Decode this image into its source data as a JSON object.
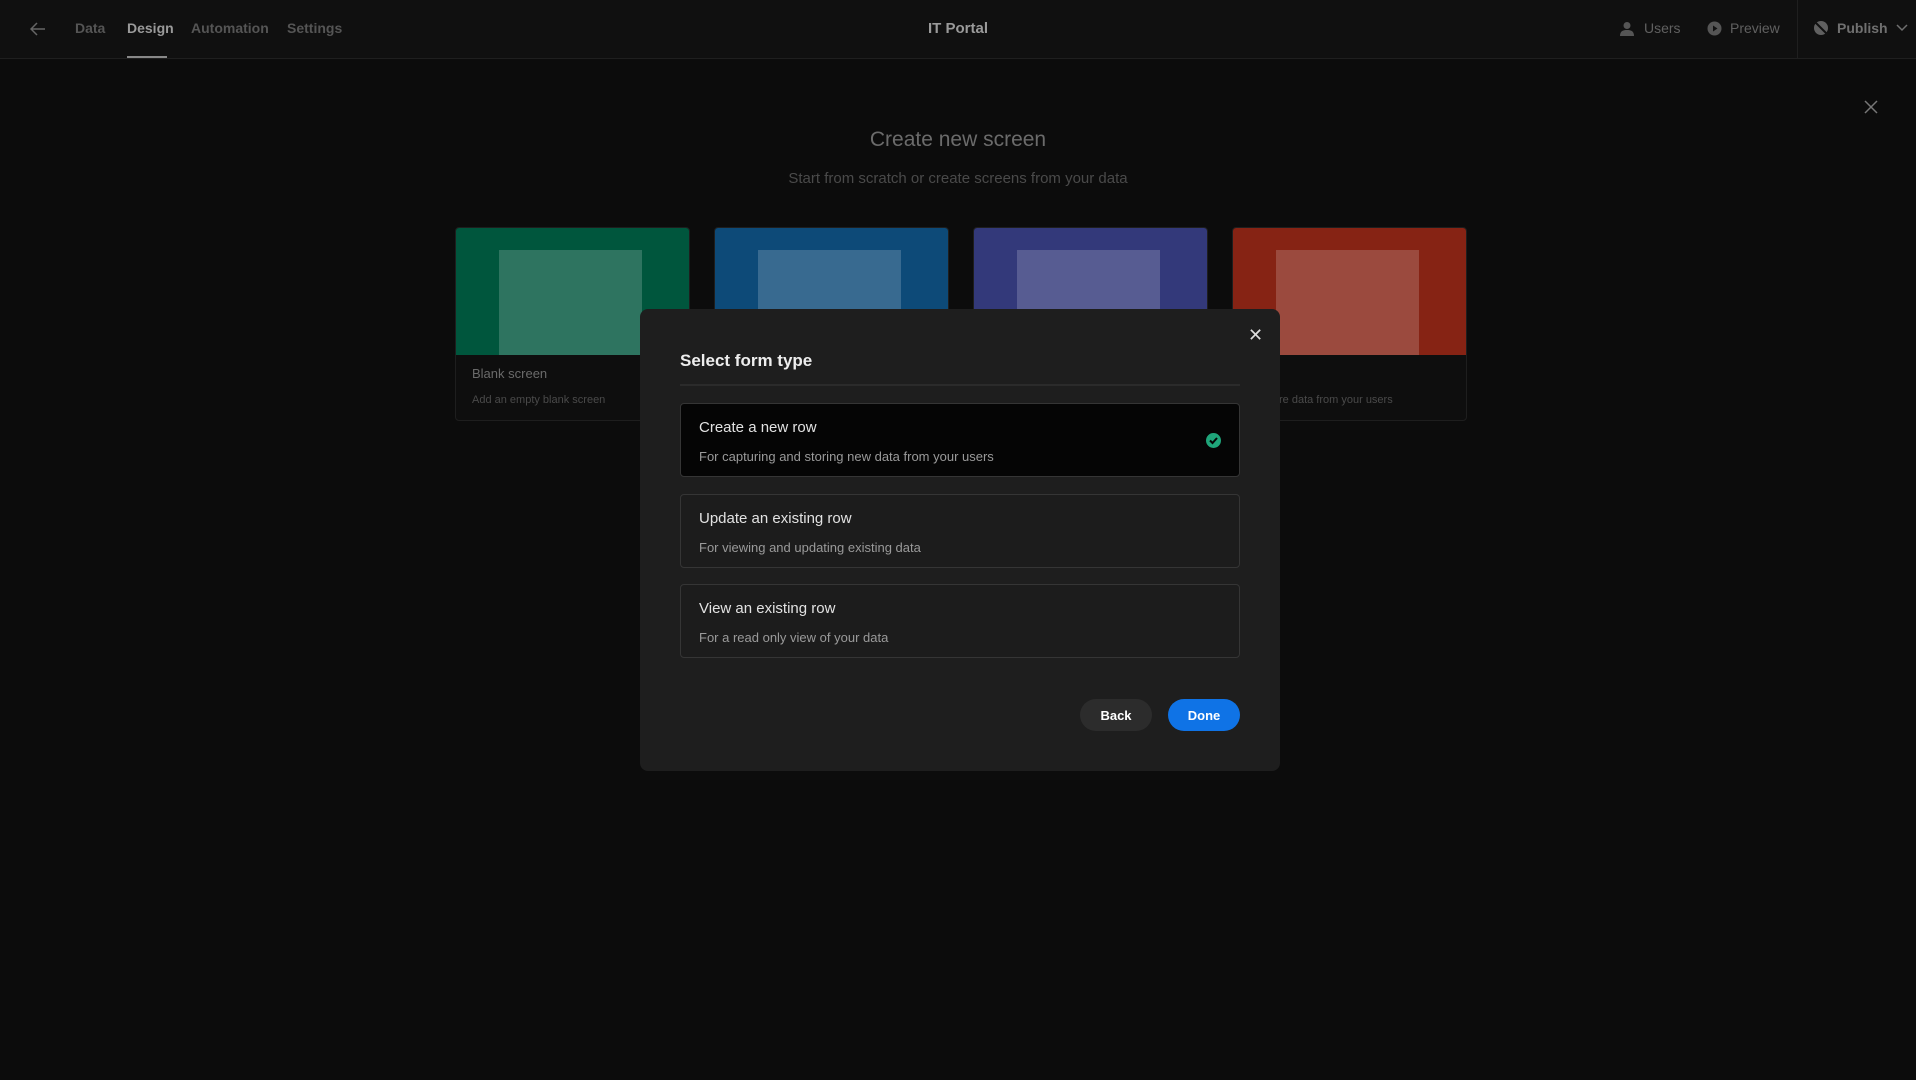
{
  "topbar": {
    "tabs": [
      {
        "label": "Data"
      },
      {
        "label": "Design",
        "active": true
      },
      {
        "label": "Automation"
      },
      {
        "label": "Settings"
      }
    ],
    "title": "IT Portal",
    "users": "Users",
    "preview": "Preview",
    "publish": "Publish"
  },
  "page": {
    "heading": "Create new screen",
    "subheading": "Start from scratch or create screens from your data",
    "cards": [
      {
        "name": "Blank screen",
        "desc": "Add an empty blank screen",
        "color": "#00563d"
      },
      {
        "name": "",
        "desc": "",
        "color": "#0d4a78"
      },
      {
        "name": "",
        "desc": "",
        "color": "#33397a"
      },
      {
        "name": "",
        "desc": "re data from your users",
        "color": "#862314"
      }
    ]
  },
  "modal": {
    "title": "Select form type",
    "options": [
      {
        "label": "Create a new row",
        "desc": "For capturing and storing new data from your users",
        "selected": true
      },
      {
        "label": "Update an existing row",
        "desc": "For viewing and updating existing data"
      },
      {
        "label": "View an existing row",
        "desc": "For a read only view of your data"
      }
    ],
    "back": "Back",
    "done": "Done",
    "accent": "#0f73e6"
  }
}
